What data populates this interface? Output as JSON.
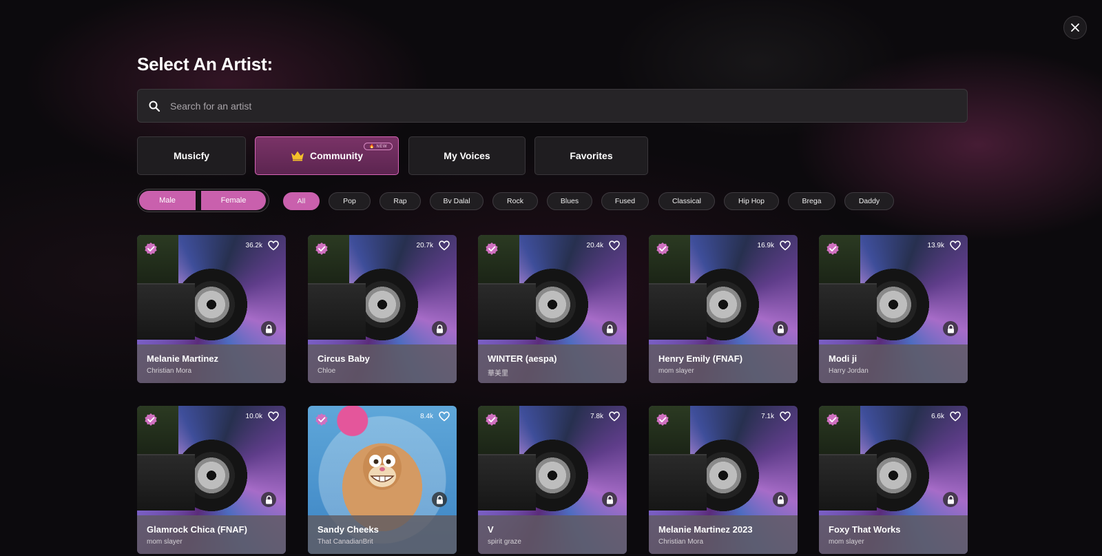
{
  "title": "Select An Artist:",
  "search": {
    "placeholder": "Search for an artist"
  },
  "tabs": [
    {
      "label": "Musicfy",
      "active": false
    },
    {
      "label": "Community",
      "active": true,
      "badge": "NEW"
    },
    {
      "label": "My Voices",
      "active": false
    },
    {
      "label": "Favorites",
      "active": false
    }
  ],
  "gender": [
    "Male",
    "Female"
  ],
  "genres": [
    "All",
    "Pop",
    "Rap",
    "Bv Dalal",
    "Rock",
    "Blues",
    "Fused",
    "Classical",
    "Hip Hop",
    "Brega",
    "Daddy"
  ],
  "active_genre": "All",
  "colors": {
    "accent": "#c960ad",
    "active_tab_border": "#d864b8"
  },
  "artists": [
    {
      "name": "Melanie Martinez",
      "creator": "Christian Mora",
      "count": "36.2k"
    },
    {
      "name": "Circus Baby",
      "creator": "Chloe",
      "count": "20.7k"
    },
    {
      "name": "WINTER (aespa)",
      "creator": "華美里",
      "count": "20.4k"
    },
    {
      "name": "Henry Emily (FNAF)",
      "creator": "mom slayer",
      "count": "16.9k"
    },
    {
      "name": "Modi ji",
      "creator": "Harry Jordan",
      "count": "13.9k"
    },
    {
      "name": "Glamrock Chica (FNAF)",
      "creator": "mom slayer",
      "count": "10.0k"
    },
    {
      "name": "Sandy Cheeks",
      "creator": "That CanadianBrit",
      "count": "8.4k",
      "art": "sandy"
    },
    {
      "name": "V",
      "creator": "spirit graze",
      "count": "7.8k"
    },
    {
      "name": "Melanie Martinez 2023",
      "creator": "Christian Mora",
      "count": "7.1k"
    },
    {
      "name": "Foxy That Works",
      "creator": "mom slayer",
      "count": "6.6k"
    }
  ]
}
